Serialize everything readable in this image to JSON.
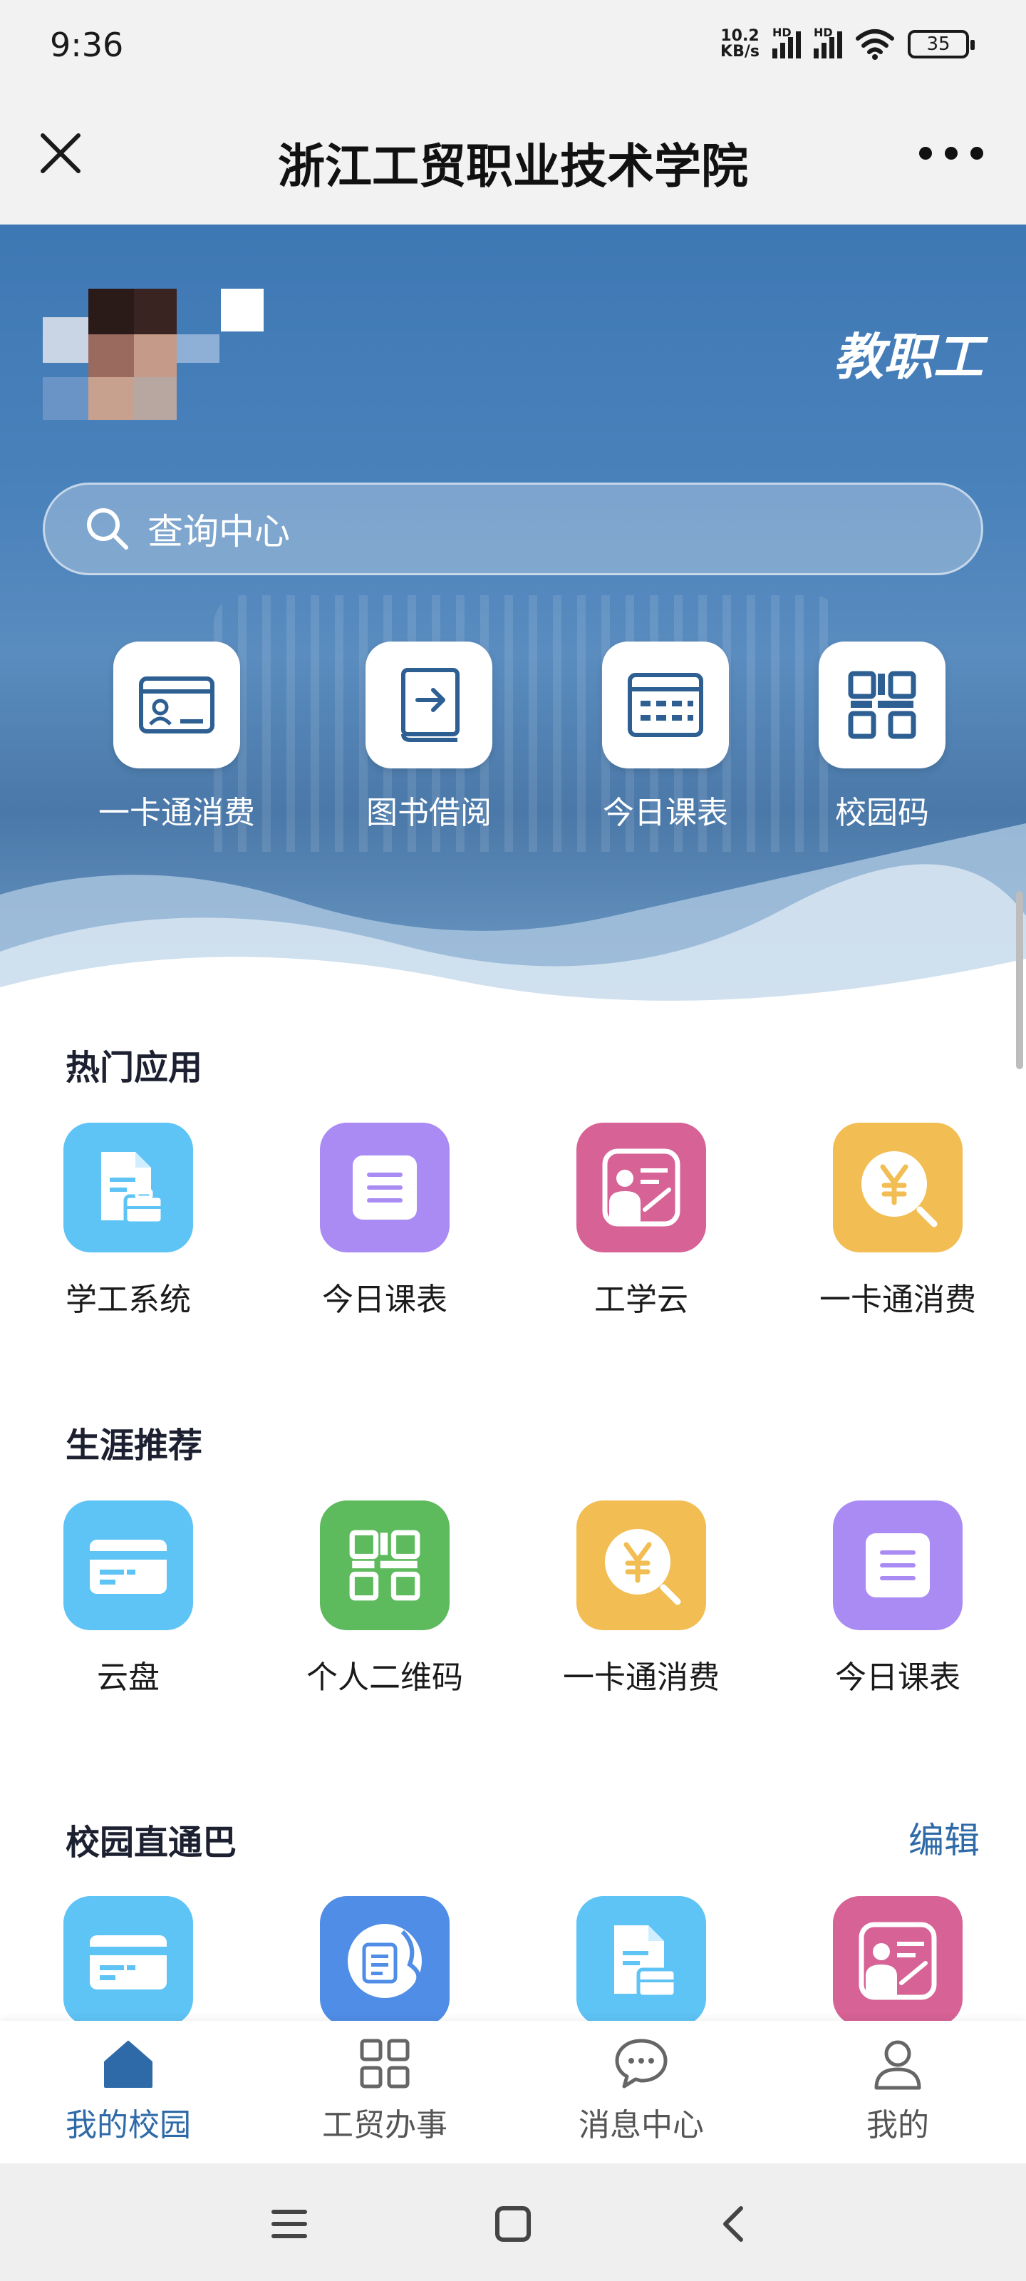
{
  "status_bar": {
    "time": "9:36",
    "net_speed_value": "10.2",
    "net_speed_unit": "KB/s",
    "sim1_tag": "HD",
    "sim2_tag": "HD",
    "battery": "35",
    "icons": [
      "signal-icon",
      "signal-icon",
      "wifi-icon",
      "battery-icon"
    ]
  },
  "nav_bar": {
    "title": "浙江工贸职业技术学院",
    "close_icon": "close-icon",
    "more_icon": "more-icon"
  },
  "header": {
    "role": "教职工",
    "search_placeholder": "查询中心",
    "quick_actions": [
      {
        "label": "一卡通消费",
        "icon": "id-card-icon"
      },
      {
        "label": "图书借阅",
        "icon": "book-icon"
      },
      {
        "label": "今日课表",
        "icon": "schedule-icon"
      },
      {
        "label": "校园码",
        "icon": "qr-code-icon"
      }
    ]
  },
  "sections": {
    "hot_apps": {
      "title": "热门应用",
      "items": [
        {
          "label": "学工系统",
          "icon": "document-briefcase-icon",
          "color": "#5ec3f5"
        },
        {
          "label": "今日课表",
          "icon": "list-icon",
          "color": "#a98bf3"
        },
        {
          "label": "工学云",
          "icon": "teacher-board-icon",
          "color": "#d76295"
        },
        {
          "label": "一卡通消费",
          "icon": "yen-search-icon",
          "color": "#f2bd52"
        }
      ]
    },
    "career": {
      "title": "生涯推荐",
      "items": [
        {
          "label": "云盘",
          "icon": "card-icon",
          "color": "#5ec3f5"
        },
        {
          "label": "个人二维码",
          "icon": "qr-code-icon",
          "color": "#5dba5d"
        },
        {
          "label": "一卡通消费",
          "icon": "yen-search-icon",
          "color": "#f2bd52"
        },
        {
          "label": "今日课表",
          "icon": "list-icon",
          "color": "#a98bf3"
        }
      ]
    },
    "campus_express": {
      "title": "校园直通巴",
      "edit_label": "编辑",
      "items": [
        {
          "icon": "card-icon",
          "color": "#5ec3f5"
        },
        {
          "icon": "globe-scroll-icon",
          "color": "#4f8de6"
        },
        {
          "icon": "document-briefcase-icon",
          "color": "#5ec3f5"
        },
        {
          "icon": "teacher-board-icon",
          "color": "#d76295"
        }
      ]
    }
  },
  "tab_bar": {
    "active_color": "#2f6aa8",
    "tabs": [
      {
        "label": "我的校园",
        "icon": "home-icon",
        "active": true
      },
      {
        "label": "工贸办事",
        "icon": "grid-icon",
        "active": false
      },
      {
        "label": "消息中心",
        "icon": "chat-icon",
        "active": false
      },
      {
        "label": "我的",
        "icon": "person-icon",
        "active": false
      }
    ]
  },
  "system_nav": {
    "icons": [
      "menu-icon",
      "home-square-icon",
      "back-icon"
    ]
  }
}
